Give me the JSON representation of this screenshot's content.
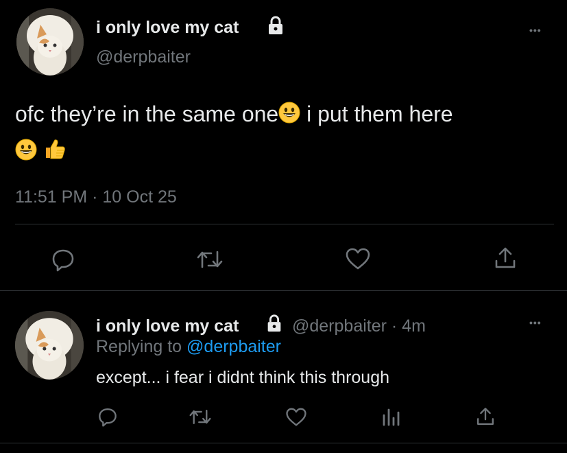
{
  "main_tweet": {
    "display_name": "i only love my cat",
    "handle": "@derpbaiter",
    "more_label": "•••",
    "text_part1": "ofc they’re in the same one",
    "text_part2": " i put them here",
    "timestamp": "11:51 PM · 10 Oct 25",
    "icons": [
      "reply-icon",
      "retweet-icon",
      "like-icon",
      "share-icon"
    ]
  },
  "reply_tweet": {
    "display_name": "i only love my cat",
    "handle_time": "@derpbaiter · 4m",
    "replying_prefix": "Replying to ",
    "replying_handle": "@derpbaiter",
    "text": "except... i fear i didnt think this through",
    "more_label": "•••",
    "icons": [
      "reply-icon",
      "retweet-icon",
      "like-icon",
      "analytics-icon",
      "share-icon"
    ]
  },
  "colors": {
    "background": "#000000",
    "text": "#e7e9ea",
    "muted": "#71767b",
    "link": "#1d9bf0",
    "divider": "#2f3336",
    "emoji_yellow": "#ffc83d"
  }
}
